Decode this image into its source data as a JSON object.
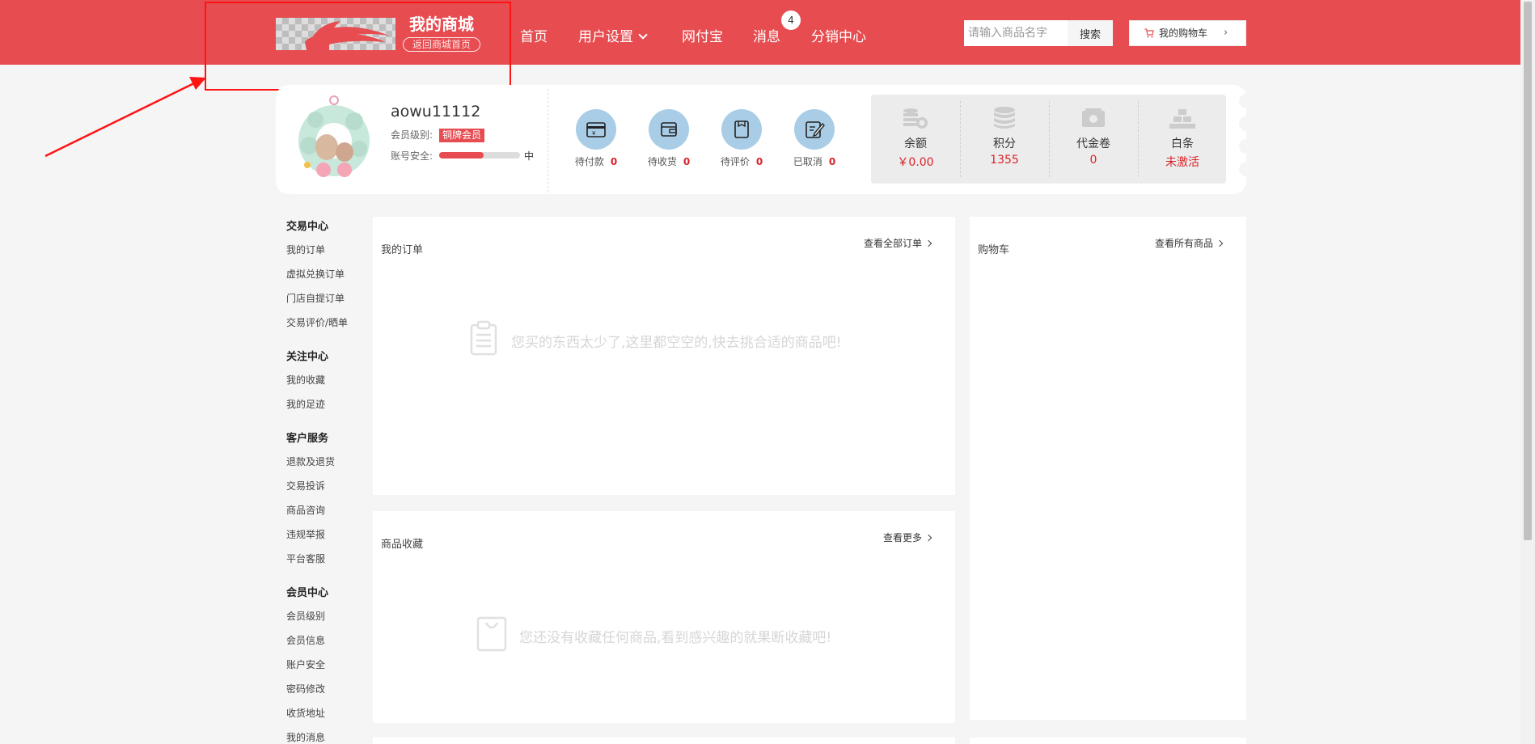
{
  "header": {
    "shop_title": "我的商城",
    "back_home": "返回商城首页",
    "nav": {
      "home": "首页",
      "user_settings": "用户设置",
      "wallet": "网付宝",
      "messages": "消息",
      "message_count": "4",
      "distribution": "分销中心"
    },
    "search": {
      "placeholder": "请输入商品名字",
      "button": "搜索"
    },
    "cart_button": "我的购物车"
  },
  "user": {
    "username": "aowu11112",
    "level_label": "会员级别:",
    "level_value": "铜牌会员",
    "security_label": "账号安全:",
    "security_level": "中",
    "security_progress": 0.55
  },
  "order_stats": [
    {
      "label": "待付款",
      "count": "0",
      "icon": "payment-icon"
    },
    {
      "label": "待收货",
      "count": "0",
      "icon": "wallet-icon"
    },
    {
      "label": "待评价",
      "count": "0",
      "icon": "review-icon"
    },
    {
      "label": "已取消",
      "count": "0",
      "icon": "cancel-edit-icon"
    }
  ],
  "assets": [
    {
      "name": "余额",
      "value": "￥0.00",
      "icon": "coins-icon"
    },
    {
      "name": "积分",
      "value": "1355",
      "icon": "points-stack-icon"
    },
    {
      "name": "代金卷",
      "value": "0",
      "icon": "voucher-icon"
    },
    {
      "name": "白条",
      "value": "未激活",
      "icon": "gold-bars-icon"
    }
  ],
  "sidebar": {
    "groups": [
      {
        "title": "交易中心",
        "items": [
          "我的订单",
          "虚拟兑换订单",
          "门店自提订单",
          "交易评价/晒单"
        ]
      },
      {
        "title": "关注中心",
        "items": [
          "我的收藏",
          "我的足迹"
        ]
      },
      {
        "title": "客户服务",
        "items": [
          "退款及退货",
          "交易投诉",
          "商品咨询",
          "违规举报",
          "平台客服"
        ]
      },
      {
        "title": "会员中心",
        "items": [
          "会员级别",
          "会员信息",
          "账户安全",
          "密码修改",
          "收货地址",
          "我的消息"
        ]
      }
    ]
  },
  "panels": {
    "orders": {
      "title": "我的订单",
      "link": "查看全部订单",
      "empty": "您买的东西太少了,这里都空空的,快去挑合适的商品吧!"
    },
    "favorites": {
      "title": "商品收藏",
      "link": "查看更多",
      "empty": "您还没有收藏任何商品,看到感兴趣的就果断收藏吧!"
    },
    "cart": {
      "title": "购物车",
      "link": "查看所有商品"
    }
  },
  "colors": {
    "brand_red": "#e64c50",
    "accent_red": "#d9232a",
    "icon_circle": "#a9cde6"
  }
}
